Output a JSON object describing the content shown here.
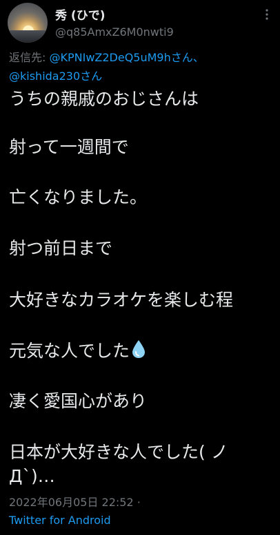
{
  "author": {
    "display_name": "秀 (ひで)",
    "handle": "@q85AmxZ6M0nwti9"
  },
  "reply_to": {
    "prefix": "返信先: ",
    "first_user": "@KPNIwZ2DeQ5uM9hさん、",
    "second_user": "@kishida230さん"
  },
  "body": {
    "lines": [
      "うちの親戚のおじさんは",
      "射って一週間で",
      "亡くなりました。",
      "射つ前日まで",
      "大好きなカラオケを楽しむ程",
      "元気な人でした",
      "凄く愛国心があり",
      "日本が大好きな人でした( ノ",
      "Д`)…"
    ],
    "emoji_after_line_6": "droplet"
  },
  "meta": {
    "timestamp": "2022年06月05日 22:52 ·",
    "source": "Twitter for Android"
  },
  "icons": {
    "avatar": "sunset-avatar",
    "more": "more-icon",
    "drop": "droplet-icon"
  },
  "colors": {
    "background": "#000000",
    "text": "#e7e9ea",
    "muted": "#71767b",
    "link": "#1d9bf0",
    "droplet": "#8fd3f4"
  }
}
